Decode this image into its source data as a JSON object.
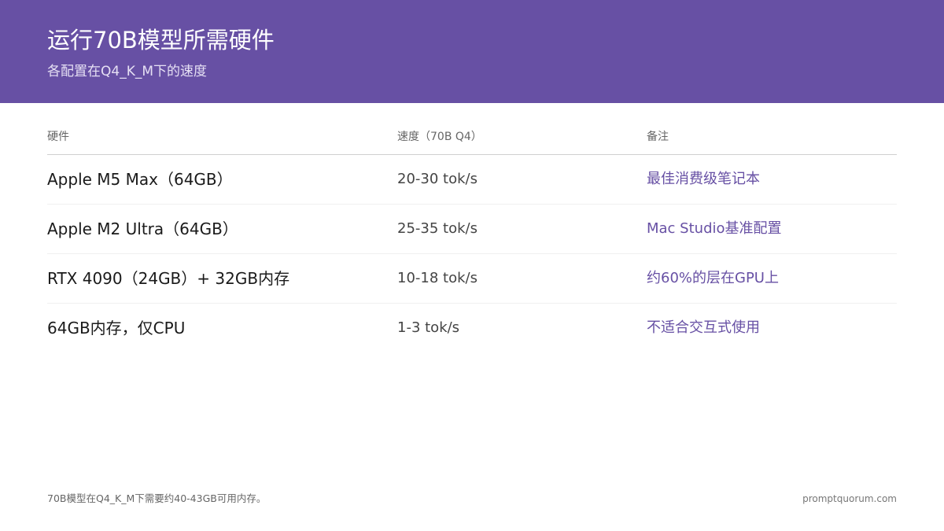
{
  "header": {
    "title": "运行70B模型所需硬件",
    "subtitle": "各配置在Q4_K_M下的速度"
  },
  "table": {
    "columns": [
      "硬件",
      "速度（70B Q4）",
      "备注"
    ],
    "rows": [
      {
        "hardware": "Apple M5 Max（64GB）",
        "speed": "20-30 tok/s",
        "note": "最佳消费级笔记本"
      },
      {
        "hardware": "Apple M2 Ultra（64GB）",
        "speed": "25-35 tok/s",
        "note": "Mac Studio基准配置"
      },
      {
        "hardware": "RTX 4090（24GB）+ 32GB内存",
        "speed": "10-18 tok/s",
        "note": "约60%的层在GPU上"
      },
      {
        "hardware": "64GB内存，仅CPU",
        "speed": "1-3 tok/s",
        "note": "不适合交互式使用"
      }
    ]
  },
  "footer": {
    "note": "70B模型在Q4_K_M下需要约40-43GB可用内存。",
    "brand": "promptquorum.com"
  },
  "colors": {
    "header_bg": "#6750a4",
    "accent": "#6750a4"
  }
}
